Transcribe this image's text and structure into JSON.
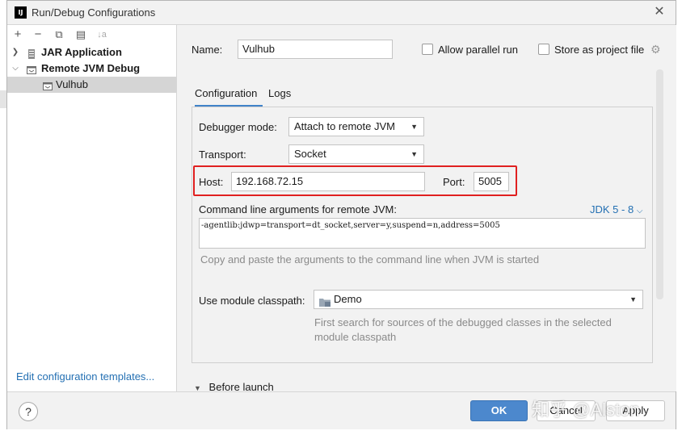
{
  "window": {
    "title": "Run/Debug Configurations",
    "app_icon_text": "IJ"
  },
  "toolbar": {
    "add": "+",
    "remove": "−",
    "copy": "⧉",
    "folder": "▤",
    "sort": "↓a"
  },
  "tree": {
    "items": [
      {
        "label": "JAR Application",
        "expanded": false,
        "bold": true
      },
      {
        "label": "Remote JVM Debug",
        "expanded": true,
        "bold": true
      },
      {
        "label": "Vulhub",
        "selected": true,
        "bold": false
      }
    ]
  },
  "edit_templates_link": "Edit configuration templates...",
  "form": {
    "name_label": "Name:",
    "name_value": "Vulhub",
    "allow_parallel_label": "Allow parallel run",
    "store_project_label": "Store as project file",
    "tabs": [
      "Configuration",
      "Logs"
    ],
    "debugger_mode_label": "Debugger mode:",
    "debugger_mode_value": "Attach to remote JVM",
    "transport_label": "Transport:",
    "transport_value": "Socket",
    "host_label": "Host:",
    "host_value": "192.168.72.15",
    "port_label": "Port:",
    "port_value": "5005",
    "cmd_label": "Command line arguments for remote JVM:",
    "jdk_link": "JDK 5 - 8",
    "cmd_value": "-agentlib:jdwp=transport=dt_socket,server=y,suspend=n,address=5005",
    "cmd_hint": "Copy and paste the arguments to the command line when JVM is started",
    "module_label": "Use module classpath:",
    "module_value": "Demo",
    "module_hint_line1": "First search for sources of the debugged classes in the selected",
    "module_hint_line2": "module classpath",
    "before_launch": "Before launch"
  },
  "buttons": {
    "help": "?",
    "ok": "OK",
    "cancel": "Cancel",
    "apply": "Apply"
  },
  "watermark": "知乎 @Alston",
  "colors": {
    "accent": "#4c88cd",
    "link": "#2470b3",
    "highlight": "#e02020"
  }
}
